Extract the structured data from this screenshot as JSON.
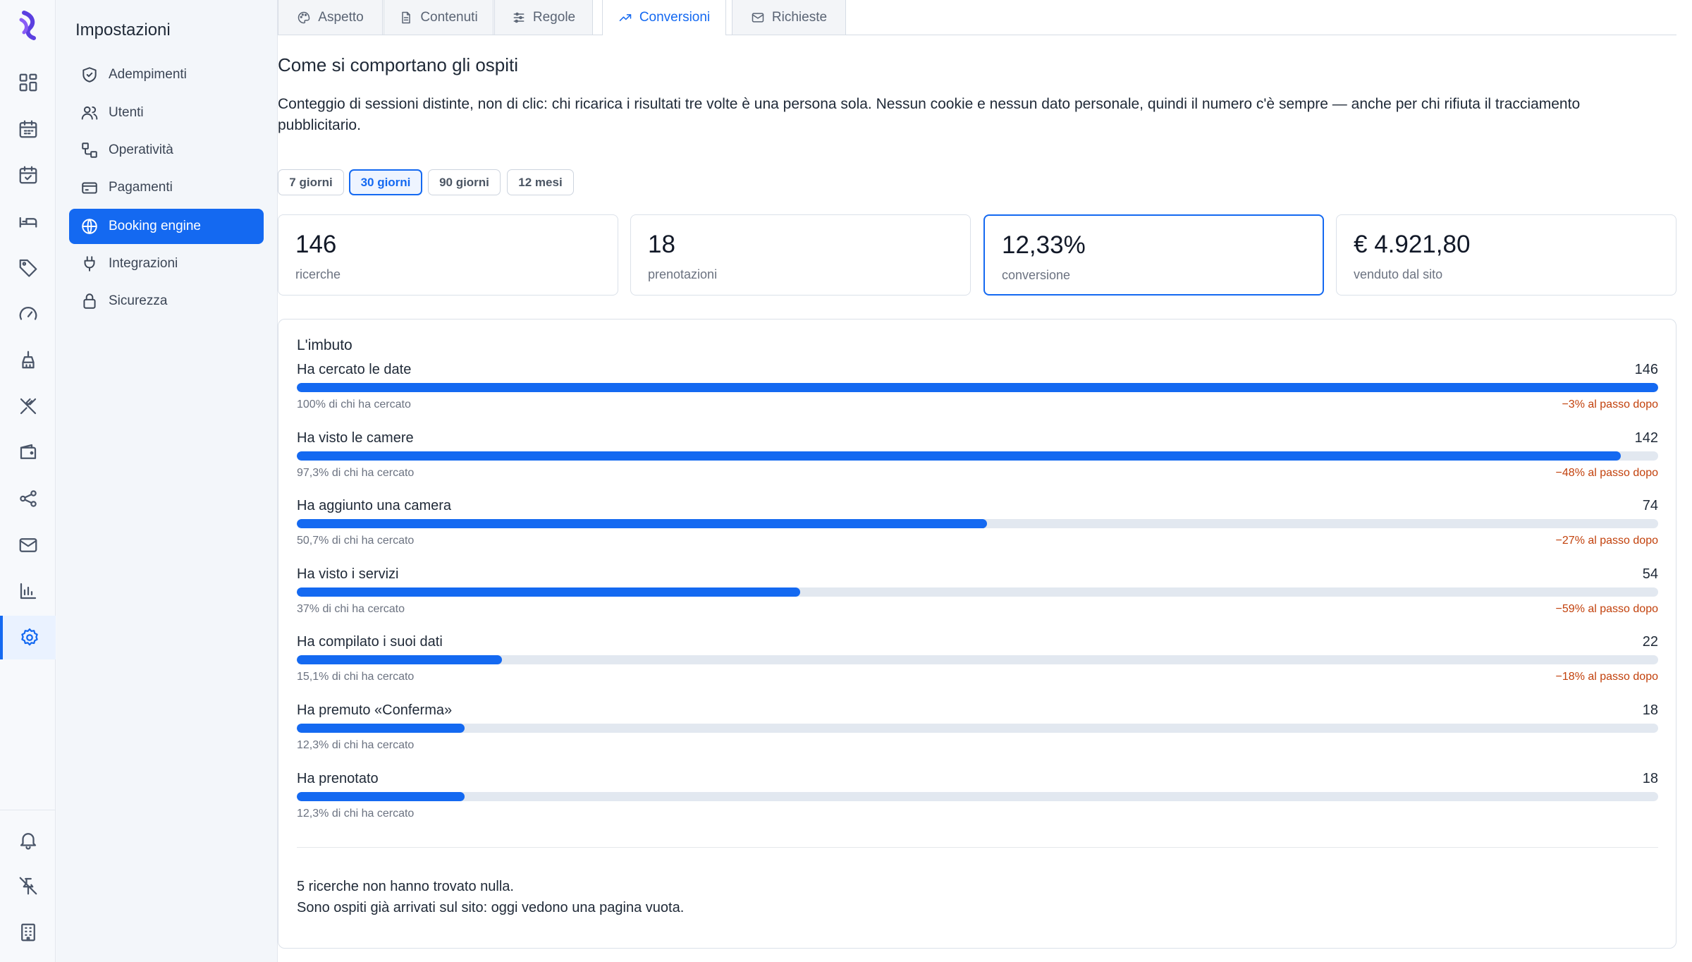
{
  "rail": {
    "items": [
      {
        "icon": "dashboard-icon"
      },
      {
        "icon": "calendar-icon"
      },
      {
        "icon": "calendar-check-icon"
      },
      {
        "icon": "bed-icon"
      },
      {
        "icon": "tag-icon"
      },
      {
        "icon": "gauge-icon"
      },
      {
        "icon": "housekeeping-icon"
      },
      {
        "icon": "restaurant-icon"
      },
      {
        "icon": "wallet-icon"
      },
      {
        "icon": "share-icon"
      },
      {
        "icon": "mail-icon"
      },
      {
        "icon": "bar-chart-icon"
      },
      {
        "icon": "settings-icon",
        "active": true
      }
    ],
    "bottom": [
      {
        "icon": "bell-icon"
      },
      {
        "icon": "unpin-icon"
      },
      {
        "icon": "building-icon"
      }
    ]
  },
  "sidebar": {
    "title": "Impostazioni",
    "items": [
      {
        "label": "Adempimenti",
        "icon": "shield-check-icon"
      },
      {
        "label": "Utenti",
        "icon": "users-icon"
      },
      {
        "label": "Operatività",
        "icon": "workflow-icon"
      },
      {
        "label": "Pagamenti",
        "icon": "credit-card-icon"
      },
      {
        "label": "Booking engine",
        "icon": "globe-icon",
        "active": true
      },
      {
        "label": "Integrazioni",
        "icon": "plug-icon"
      },
      {
        "label": "Sicurezza",
        "icon": "lock-icon"
      }
    ]
  },
  "tabs": [
    {
      "label": "Aspetto",
      "icon": "palette-icon"
    },
    {
      "label": "Contenuti",
      "icon": "document-icon"
    },
    {
      "label": "Regole",
      "icon": "sliders-icon"
    },
    {
      "label": "Conversioni",
      "icon": "trending-up-icon",
      "active": true
    },
    {
      "label": "Richieste",
      "icon": "mail-icon"
    }
  ],
  "section": {
    "heading": "Come si comportano gli ospiti",
    "description": "Conteggio di sessioni distinte, non di clic: chi ricarica i risultati tre volte è una persona sola. Nessun cookie e nessun dato personale, quindi il numero c'è sempre — anche per chi rifiuta il tracciamento pubblicitario."
  },
  "ranges": [
    {
      "label": "7 giorni"
    },
    {
      "label": "30 giorni",
      "active": true
    },
    {
      "label": "90 giorni"
    },
    {
      "label": "12 mesi"
    }
  ],
  "kpis": [
    {
      "value": "146",
      "label": "ricerche"
    },
    {
      "value": "18",
      "label": "prenotazioni"
    },
    {
      "value": "12,33%",
      "label": "conversione",
      "active": true
    },
    {
      "value": "€ 4.921,80",
      "label": "venduto dal sito"
    }
  ],
  "funnel": {
    "title": "L'imbuto",
    "steps": [
      {
        "label": "Ha cercato le date",
        "count": "146",
        "value": 146,
        "pct": "100% di chi ha cercato",
        "drop": "−3% al passo dopo"
      },
      {
        "label": "Ha visto le camere",
        "count": "142",
        "value": 142,
        "pct": "97,3% di chi ha cercato",
        "drop": "−48% al passo dopo"
      },
      {
        "label": "Ha aggiunto una camera",
        "count": "74",
        "value": 74,
        "pct": "50,7% di chi ha cercato",
        "drop": "−27% al passo dopo"
      },
      {
        "label": "Ha visto i servizi",
        "count": "54",
        "value": 54,
        "pct": "37% di chi ha cercato",
        "drop": "−59% al passo dopo"
      },
      {
        "label": "Ha compilato i suoi dati",
        "count": "22",
        "value": 22,
        "pct": "15,1% di chi ha cercato",
        "drop": "−18% al passo dopo"
      },
      {
        "label": "Ha premuto «Conferma»",
        "count": "18",
        "value": 18,
        "pct": "12,3% di chi ha cercato",
        "drop": ""
      },
      {
        "label": "Ha prenotato",
        "count": "18",
        "value": 18,
        "pct": "12,3% di chi ha cercato",
        "drop": ""
      }
    ],
    "max": 146,
    "note_line1": "5 ricerche non hanno trovato nulla.",
    "note_line2": "Sono ospiti già arrivati sul sito: oggi vedono una pagina vuota."
  },
  "colors": {
    "accent": "#1469f1",
    "drop": "#c2410c"
  }
}
